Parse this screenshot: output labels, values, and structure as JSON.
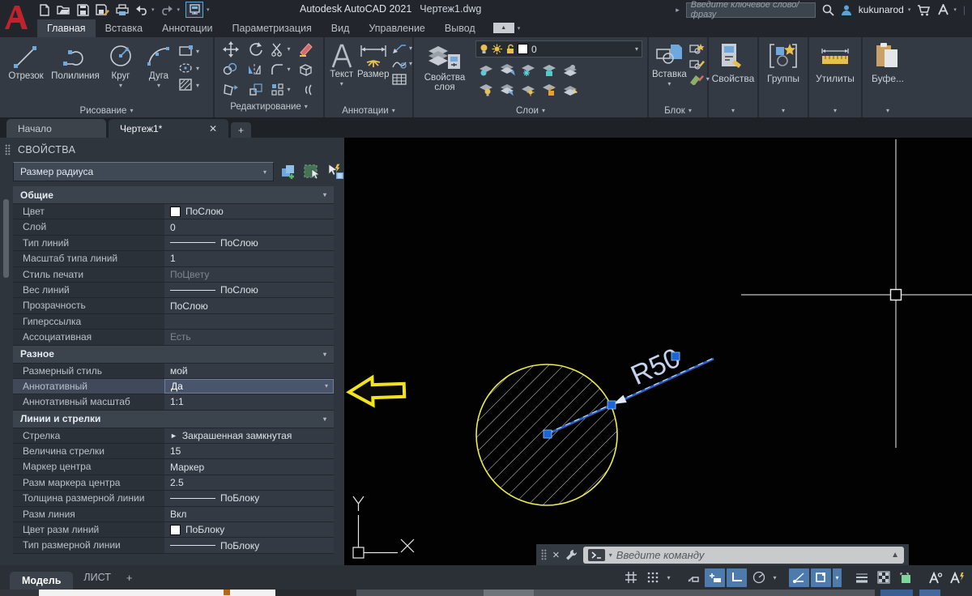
{
  "title_bar": {
    "app_title": "Autodesk AutoCAD 2021",
    "doc_title": "Чертеж1.dwg",
    "search_placeholder": "Введите ключевое слово/фразу",
    "username": "kukunarod"
  },
  "ribbon": {
    "tabs": [
      {
        "label": "Главная",
        "active": true
      },
      {
        "label": "Вставка",
        "active": false
      },
      {
        "label": "Аннотации",
        "active": false
      },
      {
        "label": "Параметризация",
        "active": false
      },
      {
        "label": "Вид",
        "active": false
      },
      {
        "label": "Управление",
        "active": false
      },
      {
        "label": "Вывод",
        "active": false
      }
    ],
    "panels": {
      "draw": {
        "label": "Рисование",
        "buttons": [
          {
            "label": "Отрезок"
          },
          {
            "label": "Полилиния"
          },
          {
            "label": "Круг"
          },
          {
            "label": "Дуга"
          }
        ]
      },
      "edit": {
        "label": "Редактирование"
      },
      "annotate": {
        "label": "Аннотации",
        "text_btn": "Текст",
        "dim_btn": "Размер"
      },
      "layers": {
        "label": "Слои",
        "props_btn": "Свойства слоя",
        "current_layer": "0"
      },
      "block": {
        "label": "Блок",
        "insert_btn": "Вставка"
      },
      "props": {
        "label": "Свойства"
      },
      "groups": {
        "label": "Группы"
      },
      "utils": {
        "label": "Утилиты"
      },
      "clipboard": {
        "label": "Буфе..."
      }
    }
  },
  "file_tabs": {
    "tabs": [
      "Начало",
      "Чертеж1*"
    ],
    "active": "Чертеж1*",
    "close_glyph": "✕",
    "add_label": "+"
  },
  "properties": {
    "title": "СВОЙСТВА",
    "selector_value": "Размер радиуса",
    "sections": [
      {
        "title": "Общие",
        "rows": [
          {
            "name": "Цвет",
            "value": "ПоСлою",
            "type": "swatch"
          },
          {
            "name": "Слой",
            "value": "0",
            "type": "text"
          },
          {
            "name": "Тип линий",
            "value": "ПоСлою",
            "type": "line"
          },
          {
            "name": "Масштаб типа линий",
            "value": "1",
            "type": "text"
          },
          {
            "name": "Стиль печати",
            "value": "ПоЦвету",
            "type": "dimtext"
          },
          {
            "name": "Вес линий",
            "value": "ПоСлою",
            "type": "line"
          },
          {
            "name": "Прозрачность",
            "value": "ПоСлою",
            "type": "text"
          },
          {
            "name": "Гиперссылка",
            "value": "",
            "type": "text"
          },
          {
            "name": "Ассоциативная",
            "value": "Есть",
            "type": "dimtext"
          }
        ]
      },
      {
        "title": "Разное",
        "rows": [
          {
            "name": "Размерный стиль",
            "value": "мой",
            "type": "text"
          },
          {
            "name": "Аннотативный",
            "value": "Да",
            "type": "dropdown",
            "selected": true
          },
          {
            "name": "Аннотативный масштаб",
            "value": "1:1",
            "type": "text"
          }
        ]
      },
      {
        "title": "Линии и стрелки",
        "rows": [
          {
            "name": "Стрелка",
            "value": "Закрашенная замкнутая",
            "type": "arrow"
          },
          {
            "name": "Величина стрелки",
            "value": "15",
            "type": "text"
          },
          {
            "name": "Маркер центра",
            "value": "Маркер",
            "type": "text"
          },
          {
            "name": "Разм маркера центра",
            "value": "2.5",
            "type": "text"
          },
          {
            "name": "Толщина размерной линии",
            "value": "ПоБлоку",
            "type": "line"
          },
          {
            "name": "Разм линия",
            "value": "Вкл",
            "type": "text"
          },
          {
            "name": "Цвет разм линий",
            "value": "ПоБлоку",
            "type": "swatch"
          },
          {
            "name": "Тип размерной линии",
            "value": "ПоБлоку",
            "type": "line"
          }
        ]
      }
    ]
  },
  "drawing": {
    "dim_text": "R50",
    "axis_x": "X",
    "axis_y": "Y",
    "circle_color": "#ecec4e",
    "dim_line_color": "#2a63c8",
    "dim_text_color": "#c3d2ee",
    "grip_color": "#1b66d6",
    "annotation_arrow_color": "#f2e41c"
  },
  "command_line": {
    "placeholder": "Введите команду"
  },
  "status_bar": {
    "model_tab": "Модель",
    "layout_tab": "ЛИСТ",
    "add_tab": "+",
    "highlight_color": "#4d7bab"
  }
}
